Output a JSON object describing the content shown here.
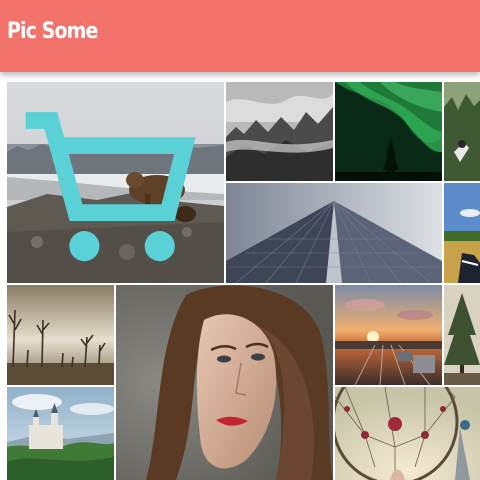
{
  "header": {
    "title": "Pic Some",
    "color": "#f2736b"
  },
  "photos": [
    {
      "id": "bear",
      "icon": "cart-icon"
    },
    {
      "id": "misty-forest"
    },
    {
      "id": "aurora-tree"
    },
    {
      "id": "person-forest-edge"
    },
    {
      "id": "skyscraper"
    },
    {
      "id": "sneakers-field"
    },
    {
      "id": "bare-trees-fog"
    },
    {
      "id": "woman-portrait"
    },
    {
      "id": "sunset-railway"
    },
    {
      "id": "pine-tree"
    },
    {
      "id": "castle"
    },
    {
      "id": "dreamcatcher"
    }
  ],
  "colors": {
    "cart_icon": "#5ad1d6"
  }
}
